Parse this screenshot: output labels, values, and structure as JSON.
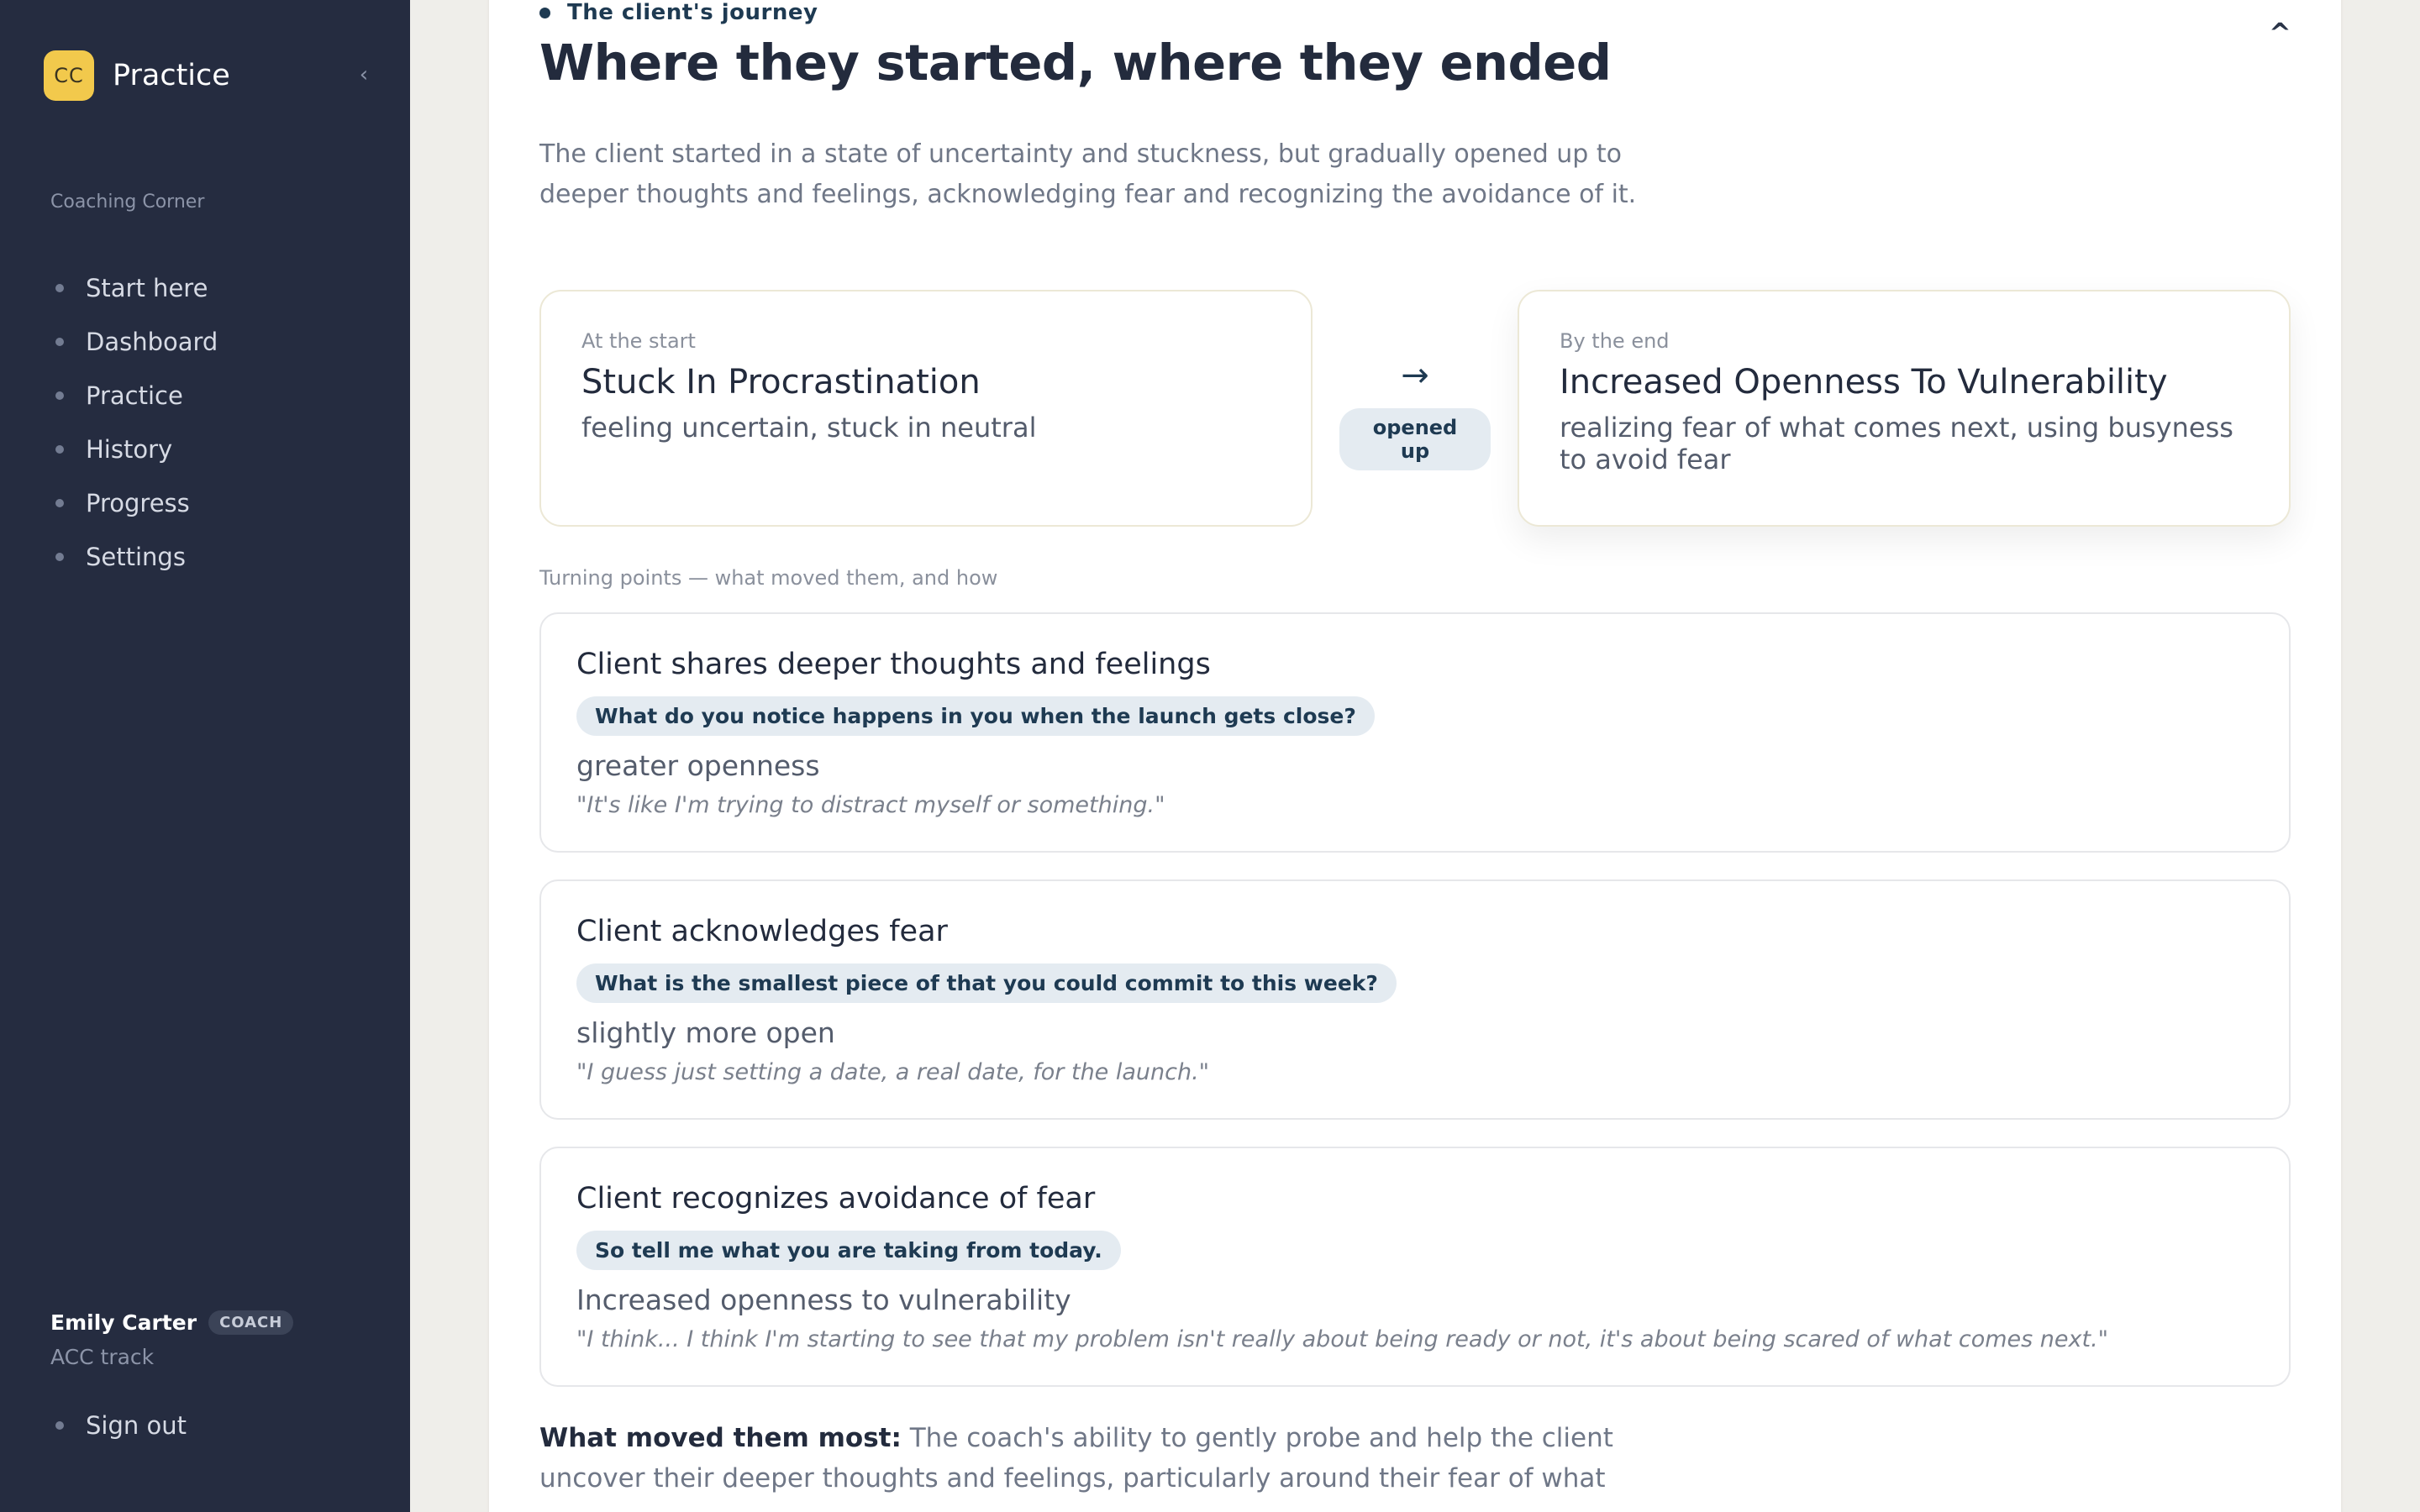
{
  "sidebar": {
    "logo_text": "CC",
    "app_name": "Practice",
    "collapse_icon": "‹",
    "section_label": "Coaching Corner",
    "items": [
      {
        "label": "Start here"
      },
      {
        "label": "Dashboard"
      },
      {
        "label": "Practice"
      },
      {
        "label": "History"
      },
      {
        "label": "Progress"
      },
      {
        "label": "Settings"
      }
    ],
    "user": {
      "name": "Emily Carter",
      "role_badge": "COACH",
      "track": "ACC track"
    },
    "sign_out": "Sign out"
  },
  "main": {
    "eyebrow": "The client's journey",
    "collapse_icon": "^",
    "title": "Where they started, where they ended",
    "summary": "The client started in a state of uncertainty and stuckness, but gradually opened up to deeper thoughts and feelings, acknowledging fear and recognizing the avoidance of it.",
    "start": {
      "label": "At the start",
      "title": "Stuck In Procrastination",
      "description": "feeling uncertain, stuck in neutral"
    },
    "transition": {
      "arrow": "→",
      "label": "opened up"
    },
    "end": {
      "label": "By the end",
      "title": "Increased Openness To Vulnerability",
      "description": "realizing fear of what comes next, using busyness to avoid fear"
    },
    "turning_label": "Turning points — what moved them, and how",
    "turning_points": [
      {
        "title": "Client shares deeper thoughts and feelings",
        "question": "What do you notice happens in you when the launch gets close?",
        "shift": "greater openness",
        "quote": "\"It's like I'm trying to distract myself or something.\""
      },
      {
        "title": "Client acknowledges fear",
        "question": "What is the smallest piece of that you could commit to this week?",
        "shift": "slightly more open",
        "quote": "\"I guess just setting a date, a real date, for the launch.\""
      },
      {
        "title": "Client recognizes avoidance of fear",
        "question": "So tell me what you are taking from today.",
        "shift": "Increased openness to vulnerability",
        "quote": "\"I think... I think I'm starting to see that my problem isn't really about being ready or not, it's about being scared of what comes next.\""
      }
    ],
    "moved_label": "What moved them most:",
    "moved_text": " The coach's ability to gently probe and help the client uncover their deeper thoughts and feelings, particularly around their fear of what"
  }
}
